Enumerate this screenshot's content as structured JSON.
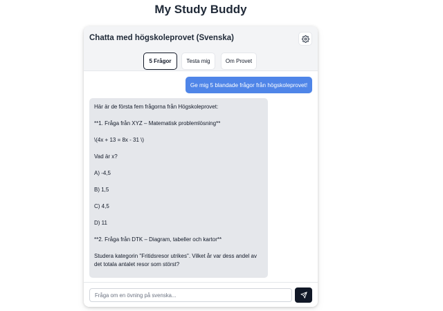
{
  "app": {
    "title": "My Study Buddy"
  },
  "chat": {
    "title": "Chatta med högskoleprovet (Svenska)",
    "settings_icon": "gear-icon"
  },
  "tabs": [
    {
      "label": "5 Frågor",
      "active": true
    },
    {
      "label": "Testa mig",
      "active": false
    },
    {
      "label": "Om Provet",
      "active": false
    }
  ],
  "messages": {
    "user": "Ge mig 5 blandade frågor från högskoleprovet!",
    "bot_lines": [
      "Här är de första fem frågorna från Högskoleprovet:",
      "**1. Fråga från XYZ – Matematisk problemlösning**",
      "\\(4x + 13 = 8x - 31 \\)",
      "Vad är x?",
      "A) -4,5",
      "B) 1,5",
      "C) 4,5",
      "D) 11",
      "**2. Fråga från DTK – Diagram, tabeller och kartor**",
      "Studera kategorin \"Fritidsresor utrikes\". Vilket år var dess andel av det totala antalet resor som störst?"
    ]
  },
  "input": {
    "placeholder": "Fråga om en övning på svenska...",
    "value": "",
    "send_icon": "send-icon"
  },
  "colors": {
    "user_bubble": "#4f85e8",
    "bot_bubble": "#e5e7eb",
    "header_bg": "#f3f4f6",
    "send_button": "#111827"
  }
}
